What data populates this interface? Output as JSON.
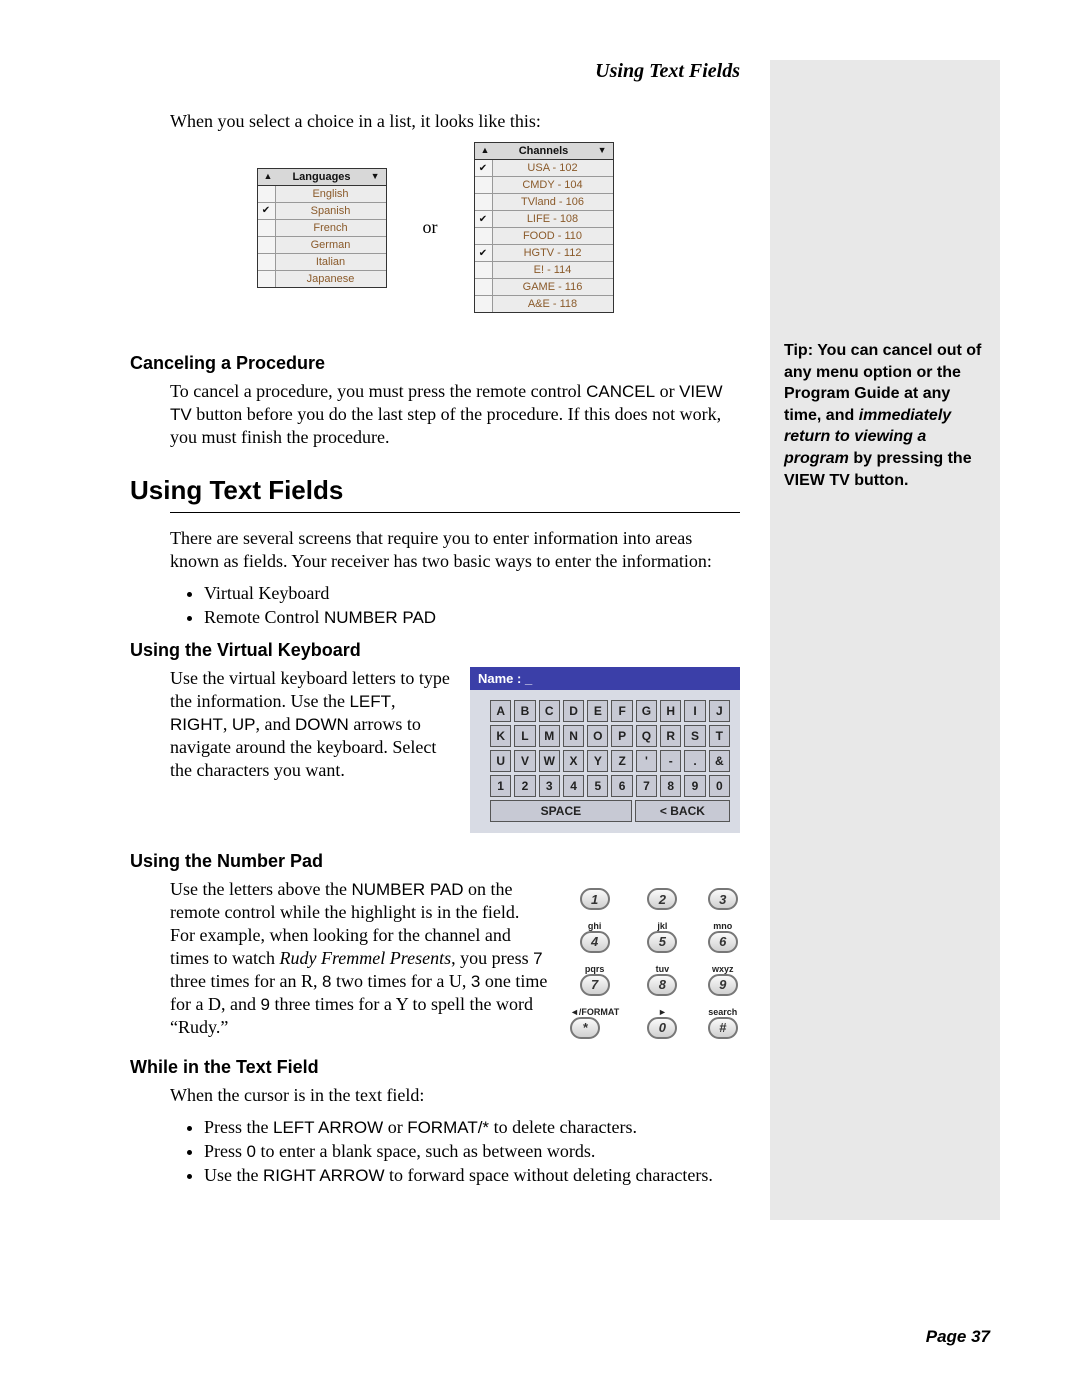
{
  "header": {
    "title": "Using Text Fields"
  },
  "intro": "When you select a choice in a list, it looks like this:",
  "listFig": {
    "languages": {
      "title": "Languages",
      "items": [
        {
          "label": "English",
          "checked": false
        },
        {
          "label": "Spanish",
          "checked": true
        },
        {
          "label": "French",
          "checked": false
        },
        {
          "label": "German",
          "checked": false
        },
        {
          "label": "Italian",
          "checked": false
        },
        {
          "label": "Japanese",
          "checked": false
        }
      ]
    },
    "or": "or",
    "channels": {
      "title": "Channels",
      "items": [
        {
          "label": "USA - 102",
          "checked": true
        },
        {
          "label": "CMDY - 104",
          "checked": false
        },
        {
          "label": "TVland - 106",
          "checked": false
        },
        {
          "label": "LIFE - 108",
          "checked": true
        },
        {
          "label": "FOOD - 110",
          "checked": false
        },
        {
          "label": "HGTV - 112",
          "checked": true
        },
        {
          "label": "E! - 114",
          "checked": false
        },
        {
          "label": "GAME - 116",
          "checked": false
        },
        {
          "label": "A&E - 118",
          "checked": false
        }
      ]
    }
  },
  "cancel": {
    "heading": "Canceling a Procedure",
    "p1a": "To cancel a procedure, you must press the remote control ",
    "p1b": "CANCEL",
    "p1c": " or ",
    "p1d": "VIEW TV",
    "p1e": " button before you do the last step of the procedure. If this does not work, you must finish the procedure."
  },
  "textfields": {
    "heading": "Using Text Fields",
    "intro": "There are several screens that require you to enter information into areas known as fields. Your receiver has two basic ways to enter the information:",
    "bullets": {
      "b1": "Virtual Keyboard",
      "b2a": "Remote Control ",
      "b2b": "NUMBER PAD"
    }
  },
  "vk": {
    "heading": "Using the Virtual Keyboard",
    "p1a": "Use the virtual keyboard letters to type the information. Use the ",
    "p1b": "LEFT",
    "p1c": ", ",
    "p1d": "RIGHT",
    "p1e": ", ",
    "p1f": "UP",
    "p1g": ", and ",
    "p1h": "DOWN",
    "p1i": " arrows to navigate around the keyboard. Select the characters you want.",
    "nameLabel": "Name : _",
    "rows": [
      [
        "A",
        "B",
        "C",
        "D",
        "E",
        "F",
        "G",
        "H",
        "I",
        "J"
      ],
      [
        "K",
        "L",
        "M",
        "N",
        "O",
        "P",
        "Q",
        "R",
        "S",
        "T"
      ],
      [
        "U",
        "V",
        "W",
        "X",
        "Y",
        "Z",
        "'",
        "-",
        ".",
        "&"
      ],
      [
        "1",
        "2",
        "3",
        "4",
        "5",
        "6",
        "7",
        "8",
        "9",
        "0"
      ]
    ],
    "space": "SPACE",
    "back": "< BACK"
  },
  "np": {
    "heading": "Using the Number Pad",
    "p1a": "Use the letters above the ",
    "p1b": "NUMBER PAD",
    "p1c": " on the remote control while the highlight is in the field. For example, when looking for the channel and times to watch ",
    "p1d": "Rudy Fremmel Presents",
    "p1e": ", you press ",
    "p1f": "7",
    "p1g": " three times for an R, ",
    "p1h": "8",
    "p1i": " two times for a U, ",
    "p1j": "3",
    "p1k": " one time for a D, and ",
    "p1l": "9",
    "p1m": " three times for a Y to spell the word “Rudy.”",
    "pad": [
      {
        "lbl": "",
        "key": "1"
      },
      {
        "lbl": "",
        "key": "2"
      },
      {
        "lbl": "",
        "key": "3"
      },
      {
        "lbl": "ghi",
        "key": "4"
      },
      {
        "lbl": "jkl",
        "key": "5"
      },
      {
        "lbl": "mno",
        "key": "6"
      },
      {
        "lbl": "pqrs",
        "key": "7"
      },
      {
        "lbl": "tuv",
        "key": "8"
      },
      {
        "lbl": "wxyz",
        "key": "9"
      },
      {
        "lbl": "◄/FORMAT",
        "key": "*"
      },
      {
        "lbl": "►",
        "key": "0"
      },
      {
        "lbl": "search",
        "key": "#"
      }
    ]
  },
  "intext": {
    "heading": "While in the Text Field",
    "intro": "When the cursor is in the text field:",
    "b1a": "Press the ",
    "b1b": "LEFT ARROW",
    "b1c": " or ",
    "b1d": "FORMAT/*",
    "b1e": " to delete characters.",
    "b2a": "Press ",
    "b2b": "0",
    "b2c": " to enter a blank space, such as between words.",
    "b3a": "Use the ",
    "b3b": "RIGHT ARROW",
    "b3c": " to forward space without deleting characters."
  },
  "tip": {
    "t1": "Tip: You can cancel out of any menu option or the Program Guide at any time, and ",
    "t2": "immediately return to viewing a program",
    "t3": " by pressing the VIEW TV button."
  },
  "footer": "Page 37"
}
